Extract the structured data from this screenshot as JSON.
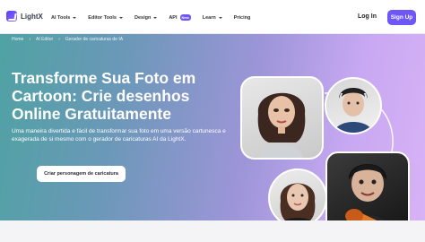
{
  "nav": {
    "logo_text": "LightX",
    "menu": [
      {
        "label": "AI Tools"
      },
      {
        "label": "Editor Tools"
      },
      {
        "label": "Design"
      },
      {
        "label": "API",
        "badge": "New"
      },
      {
        "label": "Learn"
      },
      {
        "label": "Pricing"
      }
    ],
    "login": "Log In",
    "signup": "Sign Up"
  },
  "breadcrumb": [
    "Home",
    "AI Editor",
    "Gerador de caricaturas de IA"
  ],
  "hero": {
    "title": "Transforme Sua Foto em Cartoon: Crie desenhos Online Gratuitamente",
    "description": "Uma maneira divertida e fácil de transformar sua foto em uma versão cartunesca e exagerada de si mesmo com o gerador de caricaturas AI da LightX.",
    "cta": "Criar personagem de caricatura"
  },
  "colors": {
    "accent": "#6e56f8",
    "hero_start": "#4fa2a3",
    "hero_end": "#d8b2f6"
  }
}
